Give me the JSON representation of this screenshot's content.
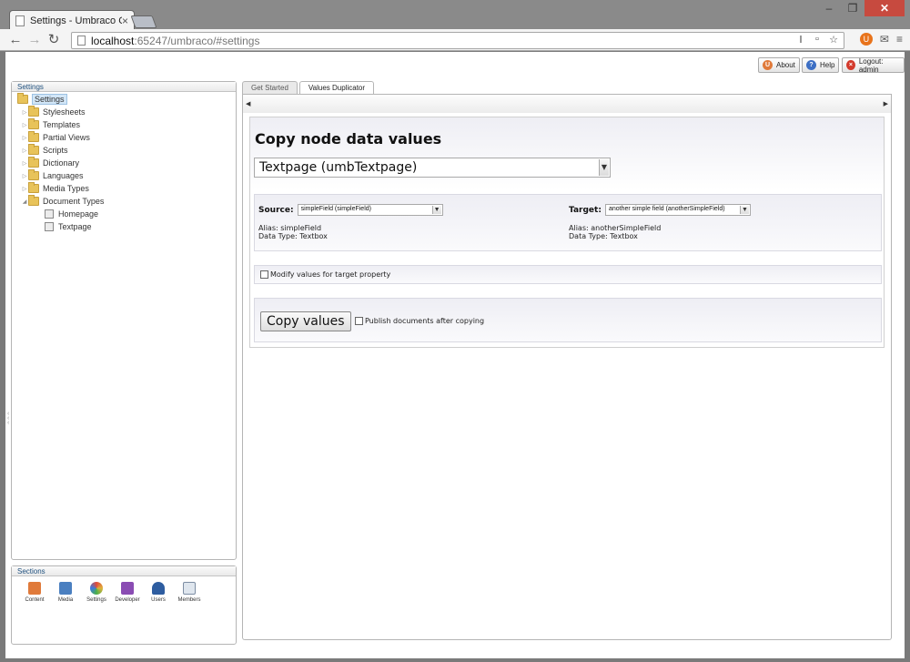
{
  "browser": {
    "tab_title": "Settings - Umbraco CMS",
    "tab_close": "×",
    "url_host": "localhost",
    "url_path": ":65247/umbraco/#settings",
    "window_buttons": [
      "–",
      "❐",
      "✕"
    ],
    "nav_icons": [
      "←",
      "→",
      "↻"
    ]
  },
  "header": {
    "about_label": "About",
    "help_label": "Help",
    "logout_label": "Logout: admin"
  },
  "tree_panel": {
    "title": "Settings",
    "root_label": "Settings",
    "items": [
      {
        "label": "Stylesheets"
      },
      {
        "label": "Templates"
      },
      {
        "label": "Partial Views"
      },
      {
        "label": "Scripts"
      },
      {
        "label": "Dictionary"
      },
      {
        "label": "Languages"
      },
      {
        "label": "Media Types"
      },
      {
        "label": "Document Types"
      }
    ],
    "children": [
      {
        "label": "Homepage"
      },
      {
        "label": "Textpage"
      }
    ]
  },
  "sections_panel": {
    "title": "Sections",
    "items": [
      {
        "label": "Content",
        "color": "#e07a3a"
      },
      {
        "label": "Media",
        "color": "#4a7fc0"
      },
      {
        "label": "Settings",
        "color": "#e0b23a"
      },
      {
        "label": "Developer",
        "color": "#8a4cb3"
      },
      {
        "label": "Users",
        "color": "#2e5da0"
      },
      {
        "label": "Members",
        "color": "#7d8da3"
      }
    ]
  },
  "content_tabs": [
    {
      "label": "Get Started"
    },
    {
      "label": "Values Duplicator"
    }
  ],
  "duplicator": {
    "heading": "Copy node data values",
    "doctype_value": "Textpage (umbTextpage)",
    "source": {
      "label": "Source:",
      "value": "simpleField (simpleField)",
      "alias": "Alias: simpleField",
      "datatype": "Data Type: Textbox"
    },
    "target": {
      "label": "Target:",
      "value": "another simple field (anotherSimpleField)",
      "alias": "Alias: anotherSimpleField",
      "datatype": "Data Type: Textbox"
    },
    "modify_label": "Modify values for target property",
    "copy_button": "Copy values",
    "publish_label": "Publish documents after copying"
  },
  "colors": {
    "accent": "#1e4f7d",
    "selected_bg": "#d2e6f7"
  }
}
